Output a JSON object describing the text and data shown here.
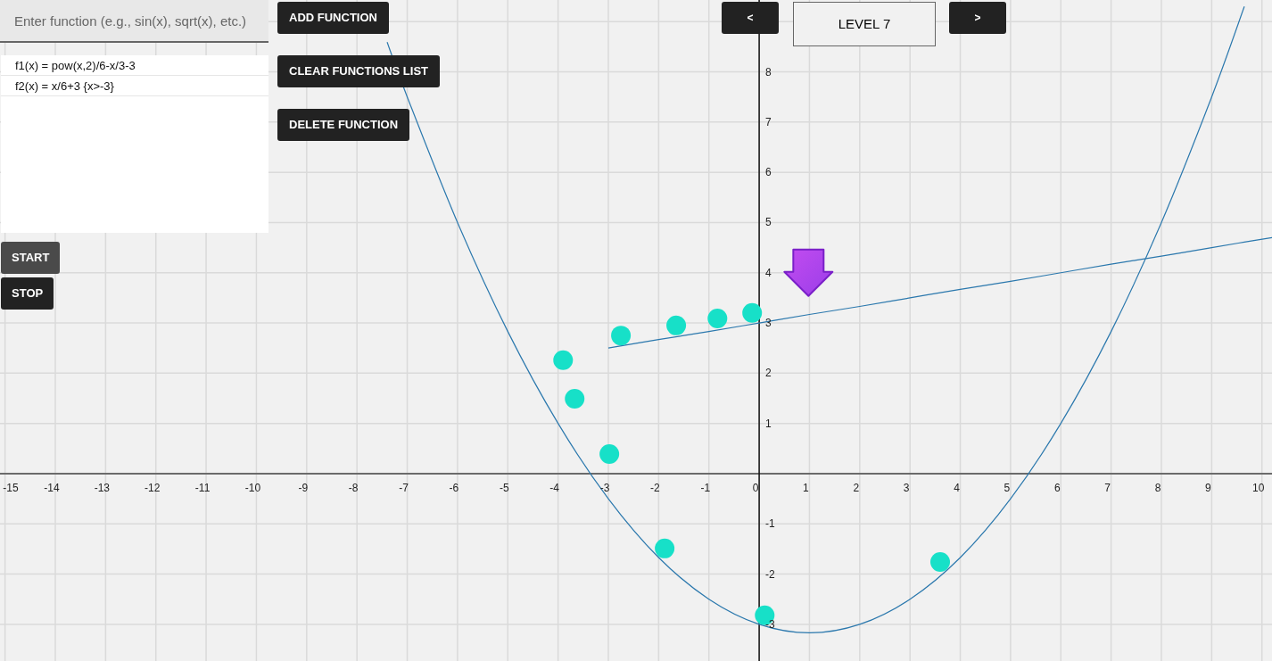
{
  "function_input": {
    "placeholder": "Enter function (e.g., sin(x), sqrt(x), etc.)"
  },
  "functions_list": [
    "f1(x) = pow(x,2)/6-x/3-3",
    "f2(x) = x/6+3 {x>-3}"
  ],
  "action_buttons": [
    "ADD FUNCTION",
    "CLEAR FUNCTIONS LIST",
    "DELETE FUNCTION"
  ],
  "run_buttons": [
    {
      "label": "START",
      "hovered": true
    },
    {
      "label": "STOP",
      "hovered": false
    }
  ],
  "level_nav": {
    "prev": "<",
    "level": "LEVEL 7",
    "next": ">"
  },
  "graph": {
    "chart_data": {
      "type": "line",
      "grid": true,
      "x": [
        -7.4,
        -7,
        -6,
        -5,
        -4,
        -3,
        -2,
        -1,
        0,
        1,
        2,
        3,
        4,
        5,
        6,
        7,
        8,
        9,
        9.65,
        10.2
      ],
      "series": [
        {
          "color": "#2b78ad",
          "values": [
            8.59,
            7.5,
            5,
            2.83,
            1,
            -0.5,
            -1.67,
            -2.5,
            -3,
            -3.17,
            -3,
            -2.5,
            -1.67,
            -0.5,
            1,
            2.83,
            5,
            7.5,
            9.3,
            null
          ]
        },
        {
          "color": "#2b78ad",
          "values": [
            null,
            null,
            null,
            null,
            null,
            2.5,
            2.67,
            2.83,
            3,
            3.17,
            3.33,
            3.5,
            3.67,
            3.83,
            4,
            4.17,
            4.33,
            4.5,
            4.61,
            4.7
          ]
        }
      ],
      "xlim": [
        -15.1,
        10.2
      ],
      "ylim": [
        -3.73,
        9.43
      ],
      "xticks": [
        -15,
        -14,
        -13,
        -12,
        -11,
        -10,
        -9,
        -8,
        -7,
        -6,
        -5,
        -4,
        -3,
        -2,
        -1,
        0,
        1,
        2,
        3,
        4,
        5,
        6,
        7,
        8,
        9,
        10
      ],
      "yticks": [
        -3,
        -2,
        -1,
        1,
        2,
        3,
        4,
        5,
        6,
        7,
        8
      ]
    }
  }
}
